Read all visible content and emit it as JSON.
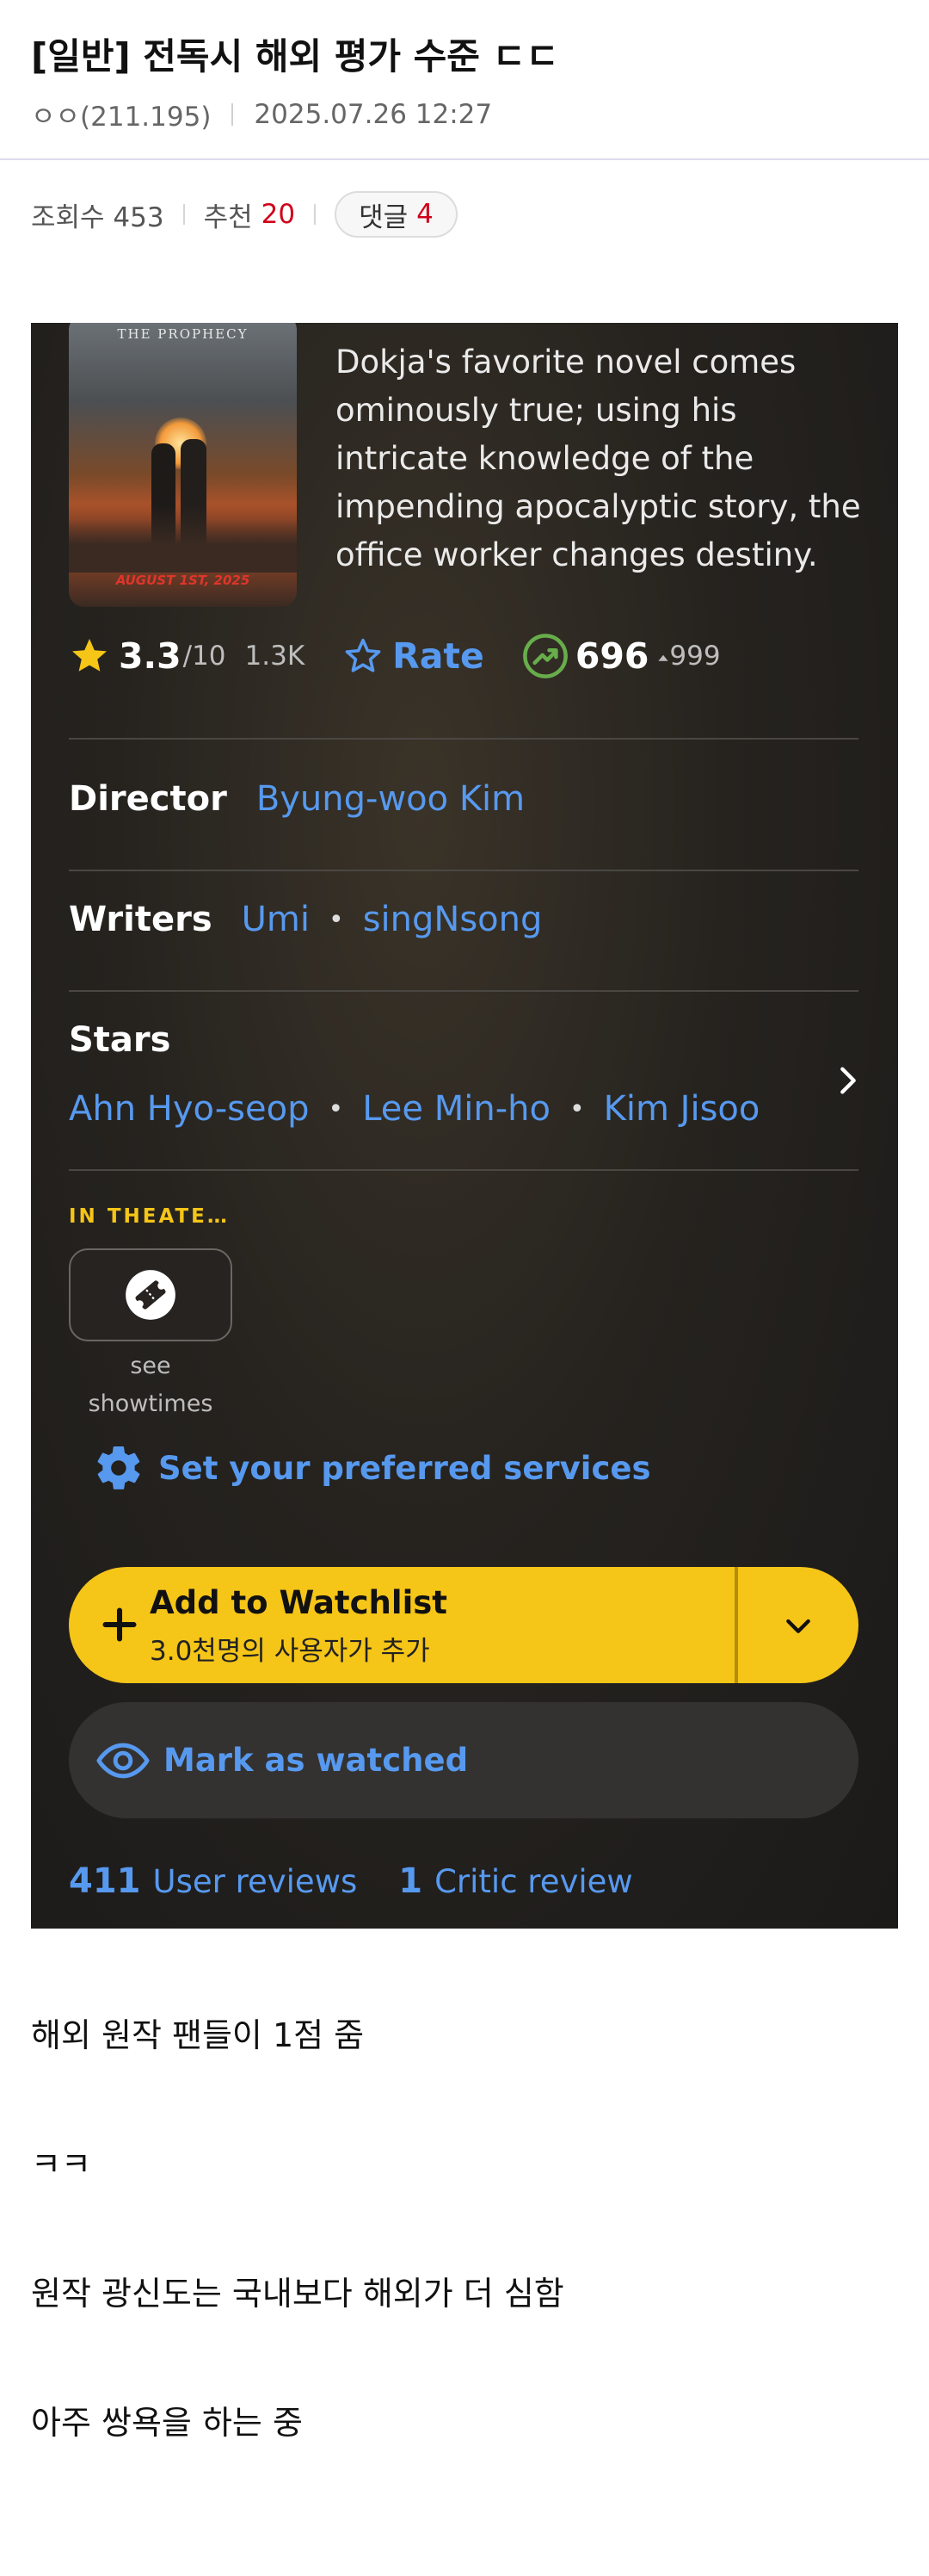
{
  "post": {
    "title": "[일반] 전독시 해외 평가 수준 ㄷㄷ",
    "author": "ㅇㅇ(211.195)",
    "datetime": "2025.07.26 12:27",
    "views_label": "조회수 453",
    "recommend_label": "추천",
    "recommend_count": "20",
    "comments_label": "댓글",
    "comments_count": "4"
  },
  "screenshot": {
    "poster": {
      "header_text": "THE PROPHECY",
      "date_text": "AUGUST 1ST, 2025"
    },
    "description": "Dokja's favorite novel comes ominously true; using his intricate knowledge of the impending apocalyptic story, the office worker changes destiny.",
    "rating": {
      "value": "3.3",
      "max": "/10",
      "count": "1.3K",
      "rate_label": "Rate",
      "popularity": "696",
      "popularity_delta": "999"
    },
    "director": {
      "label": "Director",
      "name": "Byung-woo Kim"
    },
    "writers": {
      "label": "Writers",
      "names": [
        "Umi",
        "singNsong"
      ]
    },
    "stars": {
      "label": "Stars",
      "names": [
        "Ahn Hyo-seop",
        "Lee Min-ho",
        "Kim Jisoo"
      ]
    },
    "in_theaters_label": "IN THEATE…",
    "showtimes": {
      "line1": "see",
      "line2": "showtimes"
    },
    "services_label": "Set your preferred services",
    "watchlist": {
      "title": "Add to Watchlist",
      "subtitle": "3.0천명의 사용자가 추가"
    },
    "watched_label": "Mark as watched",
    "reviews": {
      "user_count": "411",
      "user_label": "User reviews",
      "critic_count": "1",
      "critic_label": "Critic review"
    },
    "colors": {
      "accent_blue": "#5799ef",
      "imdb_yellow": "#f5c518",
      "trend_green": "#67ad4b"
    }
  },
  "body_lines": [
    "해외 원작 팬들이 1점 줌",
    "ㅋㅋ",
    "원작 광신도는 국내보다 해외가 더 심함",
    "아주 쌍욕을 하는 중"
  ]
}
